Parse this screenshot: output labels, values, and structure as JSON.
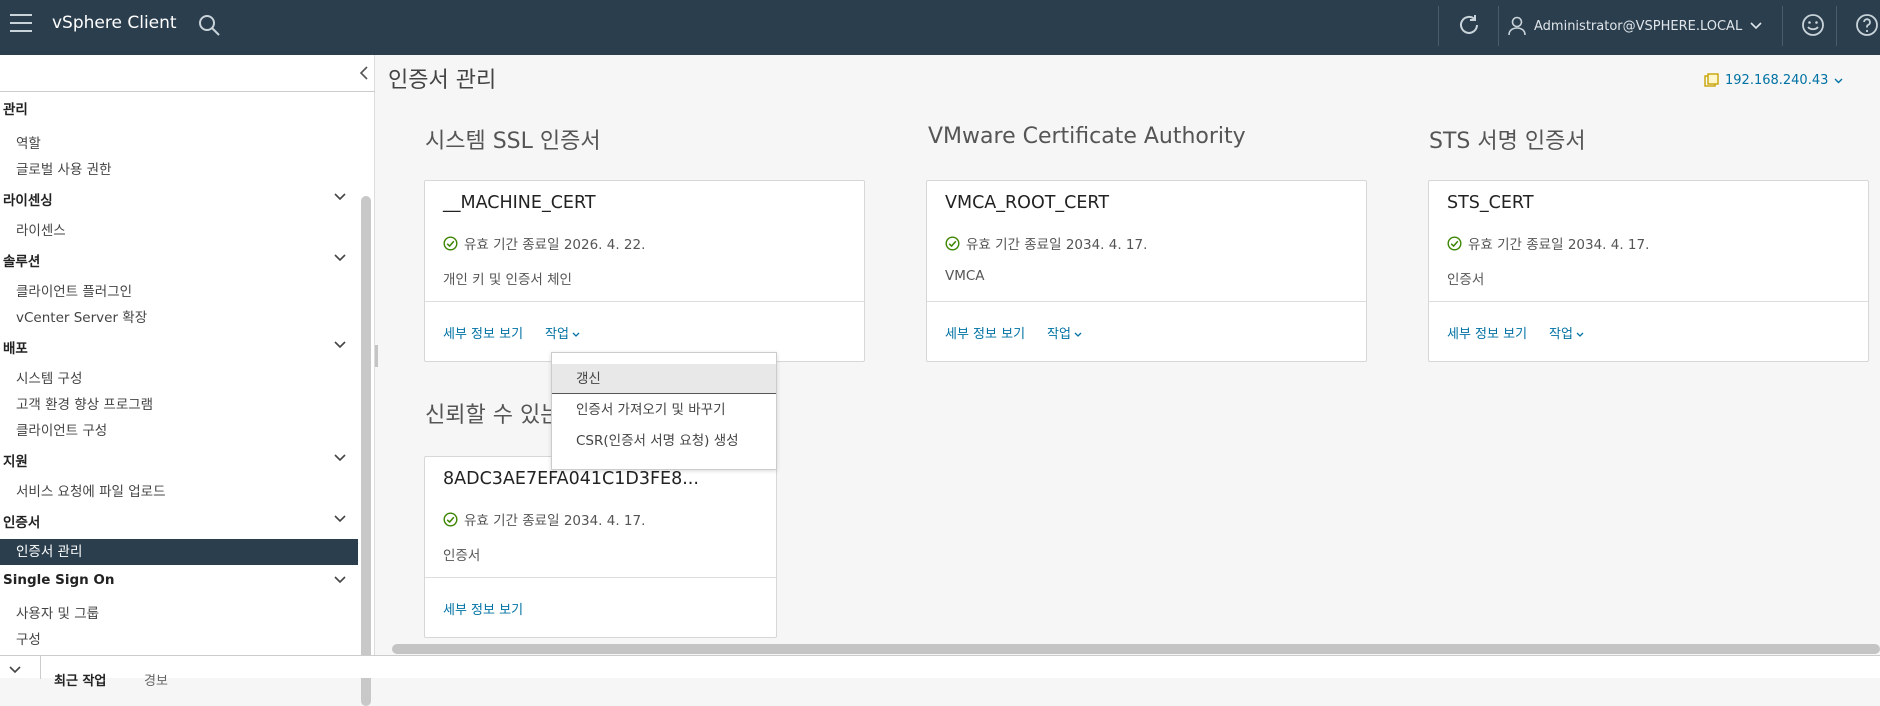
{
  "header": {
    "app_title": "vSphere Client",
    "user": "Administrator@VSPHERE.LOCAL",
    "bg_color": "#2b3e4d"
  },
  "sidebar": {
    "items": [
      {
        "label": "관리",
        "type": "section",
        "collapsible": false
      },
      {
        "label": "역할",
        "type": "item"
      },
      {
        "label": "글로벌 사용 권한",
        "type": "item"
      },
      {
        "label": "라이센싱",
        "type": "section",
        "collapsible": true
      },
      {
        "label": "라이센스",
        "type": "item"
      },
      {
        "label": "솔루션",
        "type": "section",
        "collapsible": true
      },
      {
        "label": "클라이언트 플러그인",
        "type": "item"
      },
      {
        "label": "vCenter Server 확장",
        "type": "item"
      },
      {
        "label": "배포",
        "type": "section",
        "collapsible": true
      },
      {
        "label": "시스템 구성",
        "type": "item"
      },
      {
        "label": "고객 환경 향상 프로그램",
        "type": "item"
      },
      {
        "label": "클라이언트 구성",
        "type": "item"
      },
      {
        "label": "지원",
        "type": "section",
        "collapsible": true
      },
      {
        "label": "서비스 요청에 파일 업로드",
        "type": "item"
      },
      {
        "label": "인증서",
        "type": "section",
        "collapsible": true
      },
      {
        "label": "인증서 관리",
        "type": "item",
        "active": true
      },
      {
        "label": "Single Sign On",
        "type": "section",
        "collapsible": true
      },
      {
        "label": "사용자 및 그룹",
        "type": "item"
      },
      {
        "label": "구성",
        "type": "item"
      }
    ]
  },
  "main": {
    "page_title": "인증서 관리",
    "server_ip": "192.168.240.43",
    "sections": {
      "ssl": "시스템 SSL 인증서",
      "vmca": "VMware Certificate Authority",
      "sts": "STS 서명 인증서",
      "trusted": "신뢰할 수 있는 루트 인증서"
    },
    "cards": {
      "machine": {
        "title": "__MACHINE_CERT",
        "status": "유효 기간 종료일 2026. 4. 22.",
        "desc": "개인 키 및 인증서 체인"
      },
      "vmca": {
        "title": "VMCA_ROOT_CERT",
        "status": "유효 기간 종료일 2034. 4. 17.",
        "desc": "VMCA"
      },
      "sts": {
        "title": "STS_CERT",
        "status": "유효 기간 종료일 2034. 4. 17.",
        "desc": "인증서"
      },
      "root": {
        "title": "8ADC3AE7EFA041C1D3FE8...",
        "status": "유효 기간 종료일 2034. 4. 17.",
        "desc": "인증서"
      }
    },
    "actions": {
      "details": "세부 정보 보기",
      "actions": "작업"
    },
    "dropdown": [
      "갱신",
      "인증서 가져오기 및 바꾸기",
      "CSR(인증서 서명 요청) 생성"
    ]
  },
  "bottom_panel": {
    "tabs": [
      "최근 작업",
      "경보"
    ]
  },
  "colors": {
    "accent": "#0072a3",
    "valid": "#3c8500",
    "active_item": "#2b3e4d"
  }
}
